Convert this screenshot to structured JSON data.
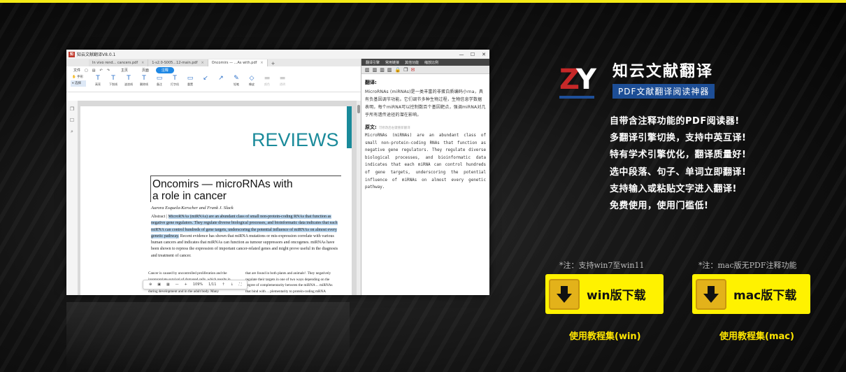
{
  "colors": {
    "accent_yellow": "#fff200",
    "brand_red": "#c62828",
    "brand_blue": "#1d4e96",
    "reviews_teal": "#1a8a9a"
  },
  "app": {
    "window_title": "知云文献翻译V8.0.1",
    "tabs": [
      {
        "label": "In vivo rend... cancers.pdf",
        "close": "×",
        "active": false
      },
      {
        "label": "1-s2.0-S005...12-main.pdf",
        "close": "×",
        "active": false
      },
      {
        "label": "Oncomirs — ...As with.pdf",
        "close": "×",
        "active": true
      }
    ],
    "tab_add": "+",
    "menu": {
      "file": "文件",
      "home": "主页",
      "page": "页面",
      "annotate": "注释"
    },
    "handtool": {
      "hand": "手形",
      "select": "选择"
    },
    "tools": [
      {
        "label": "高亮",
        "icon": "T"
      },
      {
        "label": "下划线",
        "icon": "T"
      },
      {
        "label": "波浪线",
        "icon": "T"
      },
      {
        "label": "删除线",
        "icon": "T"
      },
      {
        "label": "备注",
        "icon": "▭"
      },
      {
        "label": "打字机",
        "icon": "T"
      },
      {
        "label": "重置",
        "icon": "▭"
      },
      {
        "label": "",
        "icon": "↙"
      },
      {
        "label": "",
        "icon": "↗"
      },
      {
        "label": "铅笔",
        "icon": "✎"
      },
      {
        "label": "橡皮",
        "icon": "◇"
      },
      {
        "label": "颜色",
        "icon": "▬",
        "dim": true
      },
      {
        "label": "透明",
        "icon": "▬",
        "dim": true
      }
    ],
    "doc": {
      "reviews": "REVIEWS",
      "title_line1": "Oncomirs — microRNAs with",
      "title_line2": "a role in cancer",
      "authors": "Aurora Esquela-Kerscher and Frank J. Slack",
      "abstract_label": "Abstract | ",
      "abstract_highlight": "MicroRNAs (miRNAs) are an abundant class of small non-protein-coding RNAs that function as negative gene regulators. They regulate diverse biological processes, and bioinformatic data indicates that each miRNA can control hundreds of gene targets, underscoring the potential influence of miRNAs on almost every genetic pathway.",
      "abstract_rest": " Recent evidence has shown that miRNA mutations or mis-expression correlate with various human cancers and indicates that miRNAs can function as tumour suppressors and oncogenes. miRNAs have been shown to repress the expression of important cancer-related genes and might prove useful in the diagnosis and treatment of cancer.",
      "col1": "Cancer is caused by uncontrolled proliferation and the inappropriate survival of damaged cells, which results in tumour formation. Cells have developed several ... both during development and in the adult body. Many",
      "col2": "that are found in both plants and animals¹. They negatively regulate their targets in one of two ways depending on the degree of complementarity between the miRNA ... miRNAs that bind with ... plementarity to protein-coding mRNA sequences induce the RNA-mediated"
    },
    "zoom": {
      "zoom": "109%",
      "page": "1/11"
    },
    "translator": {
      "menu": [
        "翻译引擎",
        "常用链接",
        "其他功能",
        "缩放比例"
      ],
      "translation_heading": "翻译:",
      "translation": "MicroRNAs (miRNAs)是一类丰富的非蛋白质编码小rna，具有负基因调节功能。它们调节多种生物过程，生物信息学数据表明，每个miRNA可以控制数百个基因靶点，强调miRNA对几乎所有遗传途径的潜在影响。",
      "original_heading": "原文:",
      "original_hint": "可修改后右键重新翻译",
      "original": "MicroRNAs (miRNAs) are an abundant class of small non-protein-coding RNAs that function as negative gene regulators. They regulate diverse biological processes, and bioinformatic data indicates that each miRNA can control hundreds of gene targets, underscoring the potential influence of miRNAs on almost every genetic pathway."
    }
  },
  "promo": {
    "logo_z": "Z",
    "logo_y": "Y",
    "app_name": "知云文献翻译",
    "tagline": "PDF文献翻译阅读神器",
    "features": [
      "自带含注释功能的PDF阅读器!",
      "多翻译引擎切换，支持中英互译!",
      "特有学术引擎优化，翻译质量好!",
      "选中段落、句子、单词立即翻译!",
      "支持输入或粘贴文字进入翻译!",
      "免费使用，使用门槛低!"
    ],
    "win": {
      "note": "*注：支持win7至win11",
      "button": "win版下载",
      "tutorial": "使用教程集(win)"
    },
    "mac": {
      "note": "*注：mac版无PDF注释功能",
      "button": "mac版下载",
      "tutorial": "使用教程集(mac)"
    }
  }
}
